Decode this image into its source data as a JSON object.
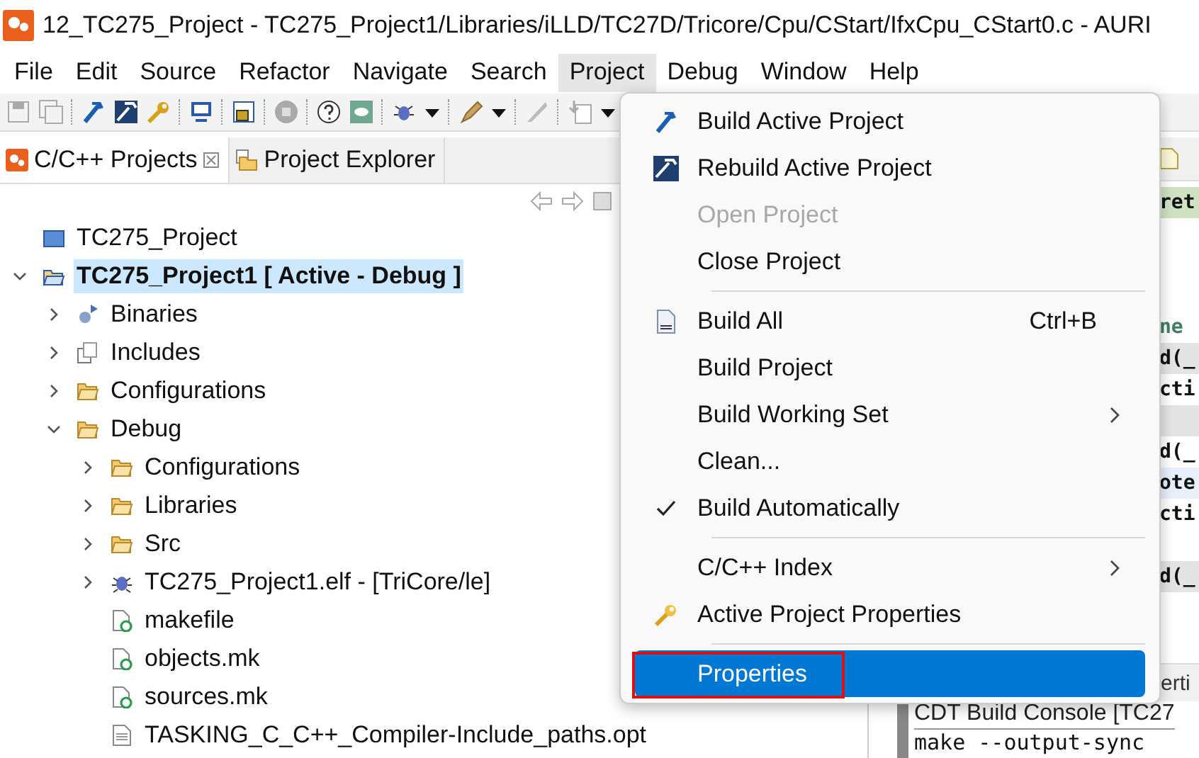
{
  "window": {
    "title": "12_TC275_Project - TC275_Project1/Libraries/iLLD/TC27D/Tricore/Cpu/CStart/IfxCpu_CStart0.c - AURI"
  },
  "menubar": [
    {
      "label": "File",
      "selected": false
    },
    {
      "label": "Edit",
      "selected": false
    },
    {
      "label": "Source",
      "selected": false
    },
    {
      "label": "Refactor",
      "selected": false
    },
    {
      "label": "Navigate",
      "selected": false
    },
    {
      "label": "Search",
      "selected": false
    },
    {
      "label": "Project",
      "selected": true
    },
    {
      "label": "Debug",
      "selected": false
    },
    {
      "label": "Window",
      "selected": false
    },
    {
      "label": "Help",
      "selected": false
    }
  ],
  "view_tabs": [
    {
      "label": "C/C++ Projects",
      "selected": true,
      "kind": "projects"
    },
    {
      "label": "Project Explorer",
      "selected": false,
      "kind": "explorer"
    }
  ],
  "tree": [
    {
      "label": "TC275_Project",
      "kind": "project",
      "selected": false
    },
    {
      "label": "TC275_Project1 [ Active - Debug ]",
      "kind": "project-open",
      "selected": true,
      "expanded": true,
      "children": [
        {
          "label": "Binaries",
          "kind": "binaries",
          "selected": false,
          "expanded": false
        },
        {
          "label": "Includes",
          "kind": "includes",
          "selected": false,
          "expanded": false
        },
        {
          "label": "Configurations",
          "kind": "folder",
          "selected": false,
          "expanded": false
        },
        {
          "label": "Debug",
          "kind": "folder",
          "selected": false,
          "expanded": true,
          "children": [
            {
              "label": "Configurations",
              "kind": "folder",
              "selected": false,
              "expanded": false
            },
            {
              "label": "Libraries",
              "kind": "folder",
              "selected": false,
              "expanded": false
            },
            {
              "label": "Src",
              "kind": "folder",
              "selected": false,
              "expanded": false
            },
            {
              "label": "TC275_Project1.elf - [TriCore/le]",
              "kind": "elf",
              "selected": false,
              "expanded": false
            },
            {
              "label": "makefile",
              "kind": "make",
              "selected": false
            },
            {
              "label": "objects.mk",
              "kind": "make",
              "selected": false
            },
            {
              "label": "sources.mk",
              "kind": "make",
              "selected": false
            },
            {
              "label": "TASKING_C_C++_Compiler-Include_paths.opt",
              "kind": "text",
              "selected": false
            }
          ]
        }
      ]
    }
  ],
  "editor_lines": [
    {
      "text": "ret",
      "kind": "match"
    },
    {
      "kind": "blank"
    },
    {
      "kind": "blank"
    },
    {
      "kind": "blank"
    },
    {
      "text": "ne",
      "kind": "comment"
    },
    {
      "text": "d(_",
      "kind": "shaded"
    },
    {
      "text": "cti",
      "kind": "plain"
    },
    {
      "kind": "shaded"
    },
    {
      "text": "d(_",
      "kind": "plain"
    },
    {
      "text": "ote",
      "kind": "current"
    },
    {
      "text": "cti",
      "kind": "plain"
    },
    {
      "kind": "blank"
    },
    {
      "text": "d(_",
      "kind": "shaded"
    }
  ],
  "bottom_tab": {
    "label": "erti"
  },
  "console": {
    "title": "CDT Build Console [TC27",
    "lines": [
      "make --output-sync"
    ]
  },
  "project_menu": [
    {
      "kind": "build",
      "label": "Build Active Project",
      "disabled": false,
      "selected": false
    },
    {
      "kind": "rebuild",
      "label": "Rebuild Active Project",
      "disabled": false,
      "selected": false
    },
    {
      "kind": "item",
      "label": "Open Project",
      "disabled": true,
      "selected": false
    },
    {
      "kind": "item",
      "label": "Close Project",
      "disabled": false,
      "selected": false
    },
    {
      "kind": "separator"
    },
    {
      "kind": "binary",
      "label": "Build All",
      "shortcut": "Ctrl+B",
      "disabled": false,
      "selected": false
    },
    {
      "kind": "item",
      "label": "Build Project",
      "disabled": false,
      "selected": false
    },
    {
      "kind": "item",
      "label": "Build Working Set",
      "submenu": true,
      "disabled": false,
      "selected": false
    },
    {
      "kind": "item",
      "label": "Clean...",
      "disabled": false,
      "selected": false
    },
    {
      "kind": "item",
      "label": "Build Automatically",
      "checked": true,
      "disabled": false,
      "selected": false
    },
    {
      "kind": "separator"
    },
    {
      "kind": "item",
      "label": "C/C++ Index",
      "submenu": true,
      "disabled": false,
      "selected": false
    },
    {
      "kind": "wrench",
      "label": "Active Project Properties",
      "disabled": false,
      "selected": false
    },
    {
      "kind": "separator"
    },
    {
      "kind": "item",
      "label": "Properties",
      "disabled": false,
      "selected": true,
      "outlined": true
    }
  ]
}
